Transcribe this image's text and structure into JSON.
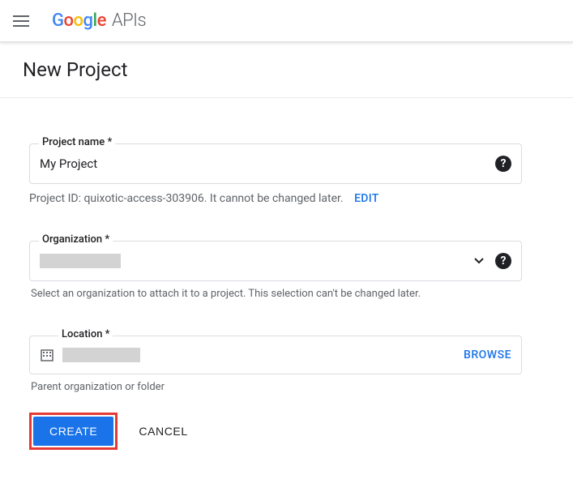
{
  "header": {
    "logo_apis": "APIs"
  },
  "page": {
    "title": "New Project"
  },
  "form": {
    "project_name": {
      "label": "Project name *",
      "value": "My Project"
    },
    "project_id": {
      "prefix": "Project ID: ",
      "id": "quixotic-access-303906",
      "suffix": ". It ",
      "warn": "cannot be changed later.",
      "edit_label": "EDIT"
    },
    "organization": {
      "label": "Organization *",
      "hint": "Select an organization to attach it to a project. This selection can't be changed later."
    },
    "location": {
      "label": "Location *",
      "browse_label": "BROWSE",
      "hint": "Parent organization or folder"
    }
  },
  "buttons": {
    "create": "CREATE",
    "cancel": "CANCEL"
  }
}
